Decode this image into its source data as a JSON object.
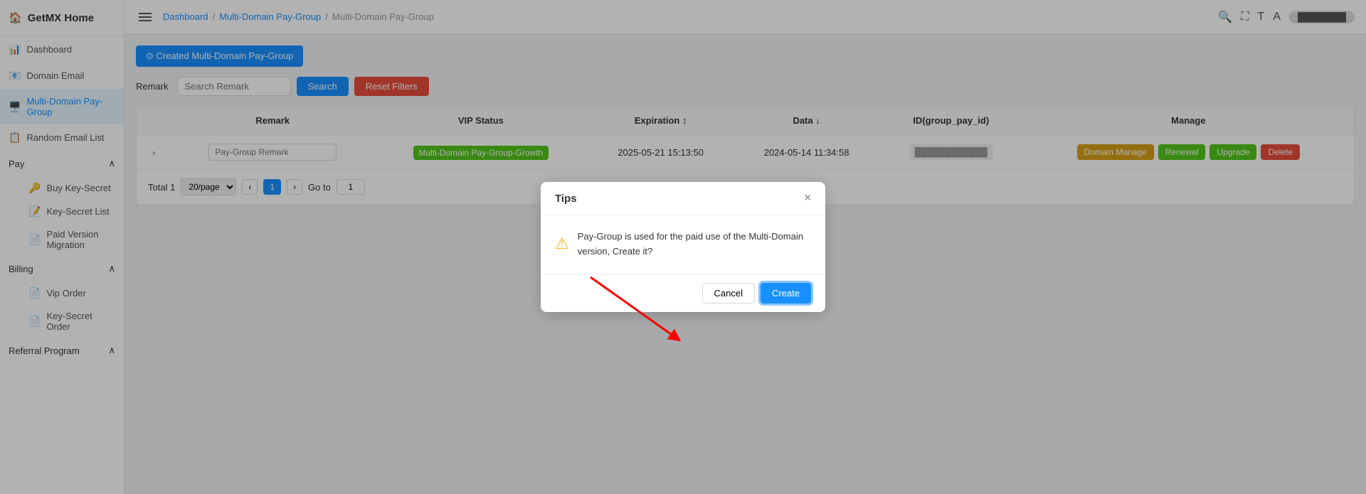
{
  "sidebar": {
    "logo": "GetMX Home",
    "items": [
      {
        "id": "home",
        "label": "GetMX Home",
        "icon": "🏠"
      },
      {
        "id": "dashboard",
        "label": "Dashboard",
        "icon": "📊"
      },
      {
        "id": "domain-email",
        "label": "Domain Email",
        "icon": "📧"
      },
      {
        "id": "multi-domain",
        "label": "Multi-Domain Pay-Group",
        "icon": "🖥️",
        "active": true
      },
      {
        "id": "random-email",
        "label": "Random Email List",
        "icon": "📋"
      },
      {
        "id": "pay-group",
        "label": "Pay",
        "icon": "",
        "expandable": true
      },
      {
        "id": "buy-key-secret",
        "label": "Buy Key-Secret",
        "icon": "🔑",
        "sub": true
      },
      {
        "id": "key-secret-list",
        "label": "Key-Secret List",
        "icon": "📝",
        "sub": true
      },
      {
        "id": "paid-version",
        "label": "Paid Version Migration",
        "icon": "📄",
        "sub": true
      },
      {
        "id": "billing",
        "label": "Billing",
        "icon": "",
        "expandable": true
      },
      {
        "id": "vip-order",
        "label": "Vip Order",
        "icon": "📄",
        "sub": true
      },
      {
        "id": "key-secret-order",
        "label": "Key-Secret Order",
        "icon": "📄",
        "sub": true
      },
      {
        "id": "referral",
        "label": "Referral Program",
        "icon": "",
        "expandable": true
      }
    ]
  },
  "topbar": {
    "hamburger": true,
    "breadcrumb": [
      "Dashboard",
      "Multi-Domain Pay-Group",
      "Multi-Domain Pay-Group"
    ],
    "icons": [
      "search",
      "expand",
      "text-size",
      "user"
    ],
    "user_label": "████████"
  },
  "content": {
    "created_btn_label": "⊙ Created Multi-Domain Pay-Group",
    "filter": {
      "label": "Remark",
      "placeholder": "Search Remark",
      "search_label": "Search",
      "reset_label": "Reset Filters"
    },
    "table": {
      "columns": [
        "Remark",
        "VIP Status",
        "Expiration ↕",
        "Data ↓",
        "ID(group_pay_id)",
        "Manage"
      ],
      "rows": [
        {
          "remark_placeholder": "Pay-Group Remark",
          "vip_status": "Multi-Domain Pay-Group-Growth",
          "expiration": "2025-05-21 15:13:50",
          "data": "2024-05-14 11:34:58",
          "id": "████████████",
          "manage": {
            "domain_manage": "Domain Manage",
            "renewal": "Renewal",
            "upgrade": "Upgrade",
            "delete": "Delete"
          }
        }
      ]
    },
    "pagination": {
      "total_label": "Total 1",
      "per_page": "20/page",
      "current_page": 1,
      "goto_label": "Go to",
      "goto_value": "1"
    }
  },
  "dialog": {
    "title": "Tips",
    "close_icon": "×",
    "message": "Pay-Group is used for the paid use of the Multi-Domain version, Create it?",
    "cancel_label": "Cancel",
    "create_label": "Create"
  }
}
